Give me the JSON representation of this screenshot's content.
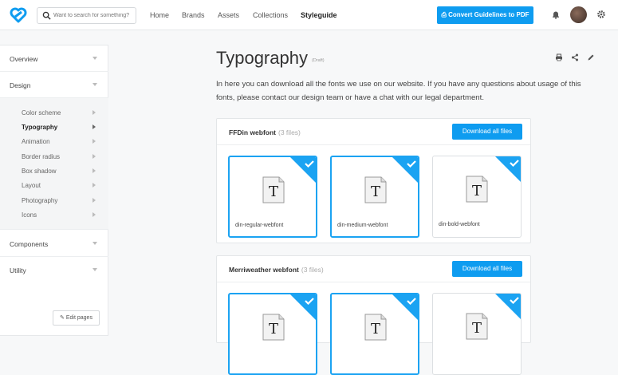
{
  "header": {
    "search_placeholder": "Want to search for something?",
    "nav": [
      "Home",
      "Brands",
      "Assets",
      "Collections",
      "Styleguide"
    ],
    "active_nav": "Styleguide",
    "pdf_button": "Convert Guidelines to PDF",
    "icons": [
      "logo-icon",
      "search-icon",
      "print-icon",
      "bell-icon",
      "gear-icon"
    ]
  },
  "sidebar": {
    "sections": [
      "Overview",
      "Design",
      "Components",
      "Utility"
    ],
    "design_items": [
      "Color scheme",
      "Typography",
      "Animation",
      "Border radius",
      "Box shadow",
      "Layout",
      "Photography",
      "Icons"
    ],
    "active_item": "Typography",
    "edit_button": "Edit pages"
  },
  "main": {
    "title": "Typography",
    "badge": "(Draft)",
    "intro": "In here you can download all the fonts we use on our website. If you have any questions about usage of this fonts, please contact our design team or have a chat with our legal department.",
    "groups": [
      {
        "name": "FFDin webfont",
        "count": "(3 files)",
        "download": "Download all files",
        "files": [
          "din-regular-webfont",
          "din-medium-webfont",
          "din-bold-webfont"
        ]
      },
      {
        "name": "Merriweather webfont",
        "count": "(3 files)",
        "download": "Download all files",
        "files": [
          "",
          "",
          ""
        ]
      }
    ]
  },
  "colors": {
    "accent": "#0e9cf0",
    "selected_border": "#1ba3f2"
  }
}
